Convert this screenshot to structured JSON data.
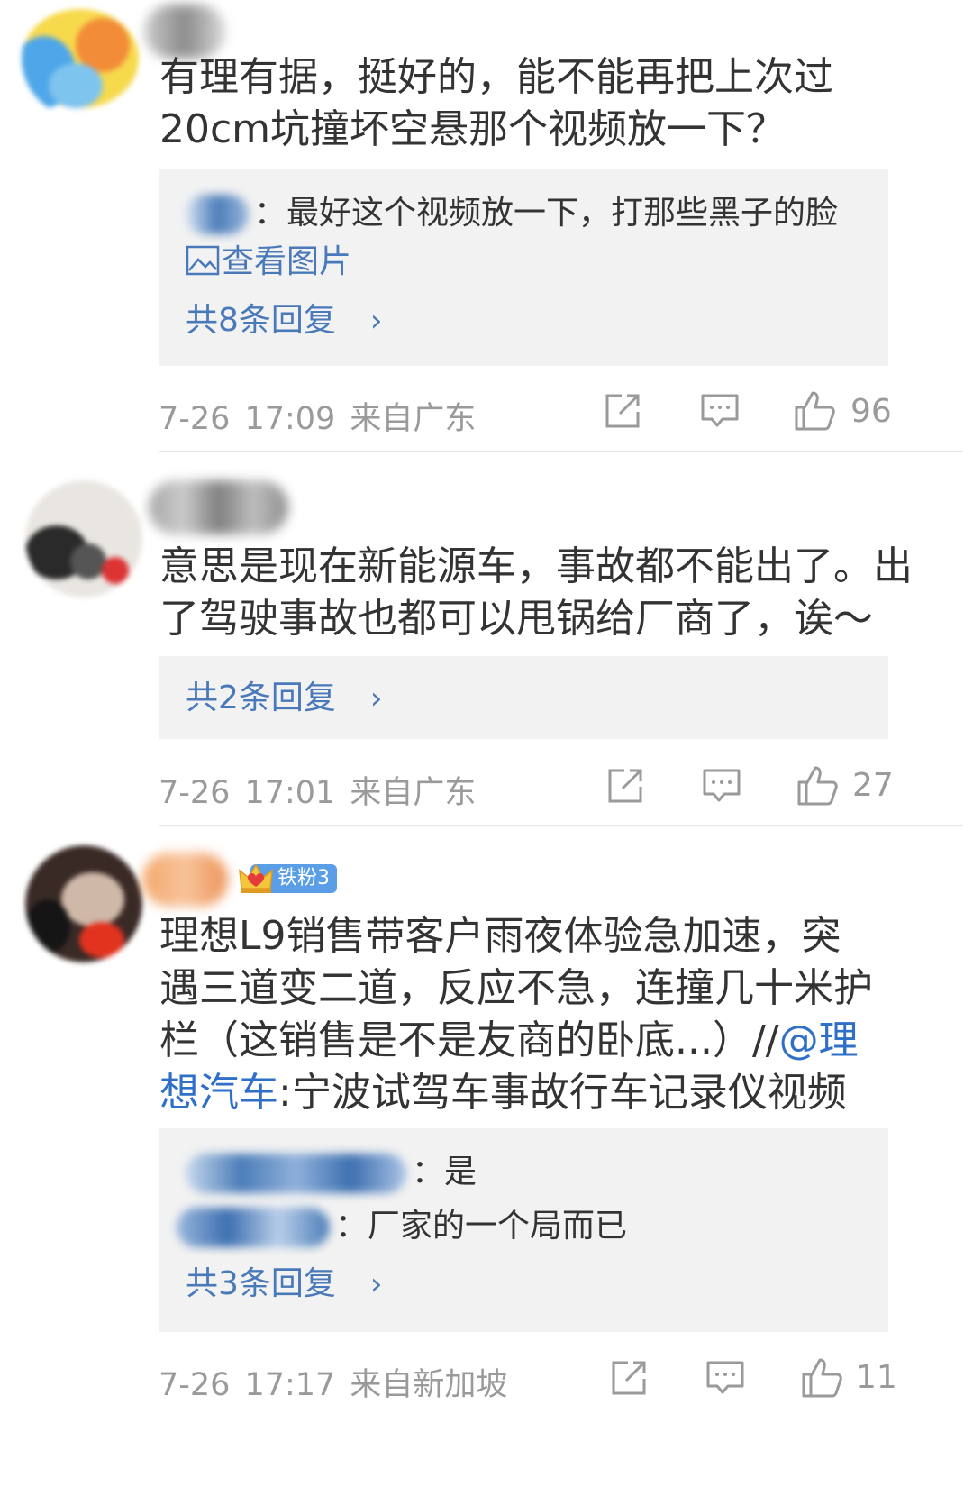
{
  "comments": [
    {
      "text": "有理有据，挺好的，能不能再把上次过20cm坑撞坏空悬那个视频放一下？",
      "replies": [
        {
          "sep": "：",
          "text": "最好这个视频放一下，打那些黑子的脸"
        }
      ],
      "view_image_label": "查看图片",
      "view_more_label": "共8条回复",
      "date": "7-26",
      "time": "17:09",
      "location": "来自广东",
      "likes": "96"
    },
    {
      "text": "意思是现在新能源车，事故都不能出了。出了驾驶事故也都可以甩锅给厂商了，诶～",
      "view_more_label": "共2条回复",
      "date": "7-26",
      "time": "17:01",
      "location": "来自广东",
      "likes": "27"
    },
    {
      "badge": "铁粉3",
      "text_before": "理想L9销售带客户雨夜体验急加速，突遇三道变二道，反应不急，连撞几十米护栏（这销售是不是友商的卧底...）//",
      "mention": "@理想汽车",
      "text_after": ":宁波试驾车事故行车记录仪视频",
      "replies": [
        {
          "sep": "：",
          "text": "是"
        },
        {
          "sep": "：",
          "text": "厂家的一个局而已"
        }
      ],
      "view_more_label": "共3条回复",
      "date": "7-26",
      "time": "17:17",
      "location": "来自新加坡",
      "likes": "11"
    }
  ],
  "icons": {
    "chevron": "›",
    "share": "share-icon",
    "comment": "comment-icon",
    "like": "thumbs-up-icon",
    "image": "image-icon"
  },
  "colors": {
    "link": "#4a79b9",
    "mention": "#2f6fc7",
    "meta": "#9a9a9a",
    "reply_bg": "#f2f2f2"
  }
}
